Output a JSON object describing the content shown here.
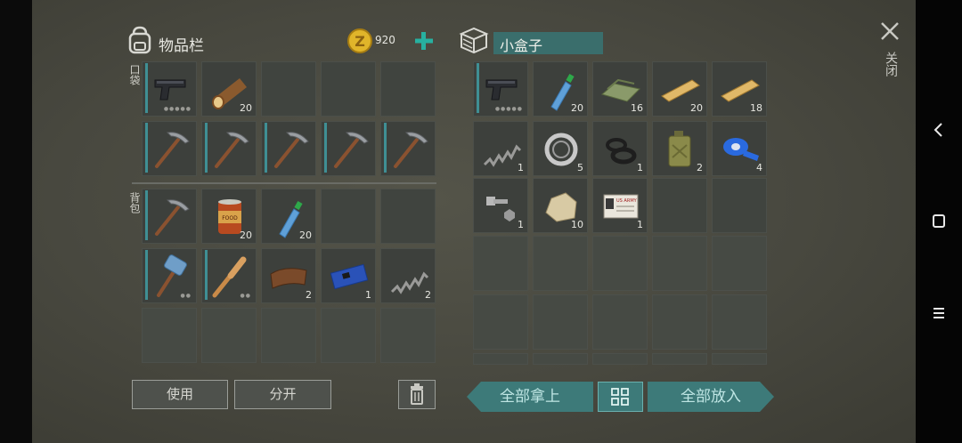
{
  "inventory": {
    "title": "物品栏",
    "coins": "920",
    "pocket_label": "口袋",
    "backpack_label": "背包",
    "pocket_row1": [
      {
        "name": "pistol",
        "count": ""
      },
      {
        "name": "log",
        "count": "20"
      },
      {
        "name": "empty",
        "count": ""
      },
      {
        "name": "empty",
        "count": ""
      },
      {
        "name": "empty",
        "count": ""
      }
    ],
    "pocket_row2": [
      {
        "name": "pickaxe"
      },
      {
        "name": "pickaxe"
      },
      {
        "name": "pickaxe"
      },
      {
        "name": "pickaxe"
      },
      {
        "name": "pickaxe"
      }
    ],
    "backpack": [
      {
        "name": "pickaxe",
        "count": ""
      },
      {
        "name": "canned-food",
        "count": "20"
      },
      {
        "name": "water-bottle",
        "count": "20"
      },
      {
        "name": "empty",
        "count": ""
      },
      {
        "name": "empty",
        "count": ""
      },
      {
        "name": "sledgehammer",
        "count": ""
      },
      {
        "name": "baseball-bat",
        "count": ""
      },
      {
        "name": "leather",
        "count": "2"
      },
      {
        "name": "circuit-board",
        "count": "1"
      },
      {
        "name": "spring",
        "count": "2"
      }
    ],
    "use_label": "使用",
    "split_label": "分开"
  },
  "box": {
    "title": "小盒子",
    "items": [
      {
        "name": "pistol",
        "count": ""
      },
      {
        "name": "water-bottle",
        "count": "20"
      },
      {
        "name": "cloth",
        "count": "16"
      },
      {
        "name": "wood-plank",
        "count": "20"
      },
      {
        "name": "wood-plank",
        "count": "18"
      },
      {
        "name": "spring",
        "count": "1"
      },
      {
        "name": "bearing",
        "count": "5"
      },
      {
        "name": "rubber-ring",
        "count": "1"
      },
      {
        "name": "jerry-can",
        "count": "2"
      },
      {
        "name": "duct-tape",
        "count": "4"
      },
      {
        "name": "bolt-nut",
        "count": "1"
      },
      {
        "name": "stone",
        "count": "10"
      },
      {
        "name": "army-id-card",
        "count": "1"
      }
    ],
    "take_all_label": "全部拿上",
    "put_all_label": "全部放入"
  },
  "close_label": "关闭",
  "id_card_text": "US ARMY",
  "food_can_text": "FOOD",
  "colors": {
    "accent": "#3d7a79",
    "durability": "#3f8f94",
    "coin": "#e0b52a",
    "plus": "#27b0a0"
  }
}
